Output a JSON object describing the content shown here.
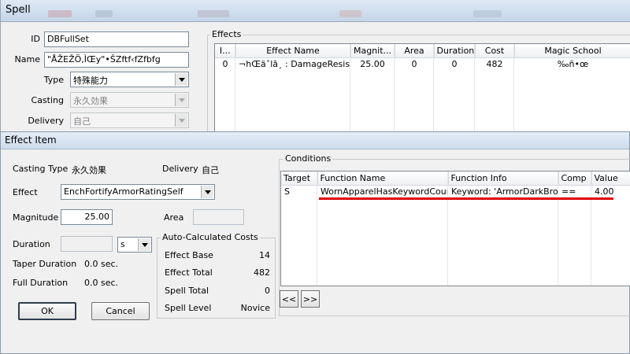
{
  "spell": {
    "title": "Spell",
    "id_label": "ID",
    "id_value": "DBFullSet",
    "name_label": "Name",
    "name_value": "\"ÅŽEŽÖ,ÌŒy\"•ŠZftf‹fZfbfg",
    "type_label": "Type",
    "type_value": "特殊能力",
    "casting_label": "Casting",
    "casting_value": "永久効果",
    "delivery_label": "Delivery",
    "delivery_value": "自己",
    "effects_group_label": "Effects",
    "effects_columns": [
      "I...",
      "Effect Name",
      "Magnit...",
      "Area",
      "Duration",
      "Cost",
      "Magic School"
    ],
    "effects_rows": [
      [
        "0",
        "¬hŒäˆlã¸ : DamageResist",
        "25.00",
        "0",
        "0",
        "482",
        "‰ñ•œ"
      ]
    ]
  },
  "effect_item": {
    "title": "Effect Item",
    "casting_type_label": "Casting Type",
    "casting_type_value": "永久効果",
    "delivery_label": "Delivery",
    "delivery_value": "自己",
    "effect_label": "Effect",
    "effect_value": "EnchFortifyArmorRatingSelf",
    "magnitude_label": "Magnitude",
    "magnitude_value": "25.00",
    "area_label": "Area",
    "area_value": "",
    "duration_label": "Duration",
    "duration_value": "",
    "duration_unit": "s",
    "taper_duration_label": "Taper Duration",
    "taper_duration_value": "0.0 sec.",
    "full_duration_label": "Full Duration",
    "full_duration_value": "0.0 sec.",
    "auto_costs_label": "Auto-Calculated Costs",
    "effect_base_label": "Effect Base",
    "effect_base_value": "14",
    "effect_total_label": "Effect Total",
    "effect_total_value": "482",
    "spell_total_label": "Spell Total",
    "spell_total_value": "0",
    "spell_level_label": "Spell Level",
    "spell_level_value": "Novice",
    "ok_label": "OK",
    "cancel_label": "Cancel",
    "conditions_label": "Conditions",
    "conditions_columns": [
      "Target",
      "Function Name",
      "Function Info",
      "Comp",
      "Value"
    ],
    "conditions_rows": [
      [
        "S",
        "WornApparelHasKeywordCount",
        "Keyword: 'ArmorDarkBro...",
        "==",
        "4.00"
      ]
    ],
    "nav_prev_label": "<<",
    "nav_next_label": ">>"
  },
  "colors": {
    "highlight_underline": "#e00000",
    "window_bg": "#f0f0f0"
  }
}
